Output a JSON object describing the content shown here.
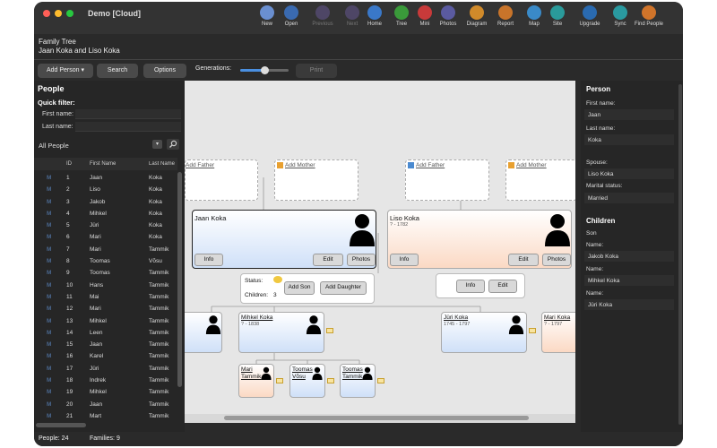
{
  "app": {
    "title": "Demo [Cloud]"
  },
  "toolbar_icons": [
    {
      "label": "New",
      "icon": "new-doc-icon",
      "color": "#6a8fd0",
      "disabled": false
    },
    {
      "label": "Open",
      "icon": "folder-icon",
      "color": "#3a6ab0",
      "disabled": false
    },
    {
      "label": "Previous",
      "icon": "back-arrow-icon",
      "color": "#6a5a9a",
      "disabled": true
    },
    {
      "label": "Next",
      "icon": "forward-arrow-icon",
      "color": "#6a5a9a",
      "disabled": true
    },
    {
      "label": "Home",
      "icon": "home-icon",
      "color": "#3a78c8",
      "disabled": false
    },
    {
      "label": "Tree",
      "icon": "tree-icon",
      "color": "#3a9a3a",
      "disabled": false
    },
    {
      "label": "Mini",
      "icon": "tag-icon",
      "color": "#c83a3a",
      "disabled": false
    },
    {
      "label": "Photos",
      "icon": "photo-icon",
      "color": "#5a5aa0",
      "disabled": false
    },
    {
      "label": "Diagram",
      "icon": "diagram-icon",
      "color": "#d08a2a",
      "disabled": false
    },
    {
      "label": "Report",
      "icon": "report-icon",
      "color": "#c8742a",
      "disabled": false
    },
    {
      "label": "Map",
      "icon": "map-icon",
      "color": "#3a8ac8",
      "disabled": false
    },
    {
      "label": "Site",
      "icon": "globe-icon",
      "color": "#2a9a9a",
      "disabled": false
    },
    {
      "label": "Upgrade",
      "icon": "upgrade-icon",
      "color": "#2a6ab0",
      "disabled": false
    },
    {
      "label": "Sync",
      "icon": "sync-icon",
      "color": "#2a9aa0",
      "disabled": false
    },
    {
      "label": "Find People",
      "icon": "find-people-icon",
      "color": "#d0742a",
      "disabled": false
    }
  ],
  "family": {
    "title": "Family Tree",
    "subtitle": "Jaan Koka and Liso Koka"
  },
  "actions": {
    "add_person": "Add Person ▾",
    "search": "Search",
    "options": "Options",
    "generations_label": "Generations:",
    "generations_fraction": 0.5,
    "print": "Print"
  },
  "people_panel": {
    "title": "People",
    "quick_filter": "Quick filter:",
    "first_name_label": "First name:",
    "last_name_label": "Last name:",
    "list_selector": "All People",
    "columns": [
      "ID",
      "First Name",
      "Last Name"
    ],
    "rows": [
      {
        "id": "1",
        "first": "Jaan",
        "last": "Koka"
      },
      {
        "id": "2",
        "first": "Liso",
        "last": "Koka"
      },
      {
        "id": "3",
        "first": "Jakob",
        "last": "Koka"
      },
      {
        "id": "4",
        "first": "Mihkel",
        "last": "Koka"
      },
      {
        "id": "5",
        "first": "Jüri",
        "last": "Koka"
      },
      {
        "id": "6",
        "first": "Mari",
        "last": "Koka"
      },
      {
        "id": "7",
        "first": "Mari",
        "last": "Tammik"
      },
      {
        "id": "8",
        "first": "Toomas",
        "last": "Võsu"
      },
      {
        "id": "9",
        "first": "Toomas",
        "last": "Tammik"
      },
      {
        "id": "10",
        "first": "Hans",
        "last": "Tammik"
      },
      {
        "id": "11",
        "first": "Mai",
        "last": "Tammik"
      },
      {
        "id": "12",
        "first": "Mari",
        "last": "Tammik"
      },
      {
        "id": "13",
        "first": "Mihkel",
        "last": "Tammik"
      },
      {
        "id": "14",
        "first": "Leen",
        "last": "Tammik"
      },
      {
        "id": "15",
        "first": "Jaan",
        "last": "Tammik"
      },
      {
        "id": "16",
        "first": "Karel",
        "last": "Tammik"
      },
      {
        "id": "17",
        "first": "Jüri",
        "last": "Tammik"
      },
      {
        "id": "18",
        "first": "Indrek",
        "last": "Tammik"
      },
      {
        "id": "19",
        "first": "Mihkel",
        "last": "Tammik"
      },
      {
        "id": "20",
        "first": "Jaan",
        "last": "Tammik"
      },
      {
        "id": "21",
        "first": "Mart",
        "last": "Tammik"
      }
    ]
  },
  "tree": {
    "add_father": "Add Father",
    "add_mother": "Add Mother",
    "husband": {
      "name": "Jaan Koka"
    },
    "wife": {
      "name": "Liso Koka",
      "dates": "? - 1782"
    },
    "info": "Info",
    "edit": "Edit",
    "photos": "Photos",
    "status_label": "Status:",
    "children_label": "Children:",
    "children_count": "3",
    "add_son": "Add Son",
    "add_daughter": "Add Daughter",
    "children": [
      {
        "name": "Mihkel Koka",
        "dates": "? - 1838"
      },
      {
        "name": "Jüri Koka",
        "dates": "1745 - 1797"
      },
      {
        "name": "Mari Koka",
        "dates": "? - 1797"
      }
    ],
    "left_dates": "? - ?",
    "grandchildren": [
      {
        "name": "Mari Tammik"
      },
      {
        "name": "Toomas Võsu"
      },
      {
        "name": "Toomas Tammik"
      }
    ]
  },
  "person_panel": {
    "title": "Person",
    "first_name_label": "First name:",
    "first_name": "Jaan",
    "last_name_label": "Last name:",
    "last_name": "Koka",
    "spouse_label": "Spouse:",
    "spouse": "Liso Koka",
    "marital_label": "Marital status:",
    "marital": "Married",
    "children_title": "Children",
    "son_label": "Son",
    "name_label": "Name:",
    "children": [
      "Jakob Koka",
      "Mihkel Koka",
      "Jüri Koka"
    ]
  },
  "status": {
    "people": "People: 24",
    "families": "Families: 9"
  }
}
